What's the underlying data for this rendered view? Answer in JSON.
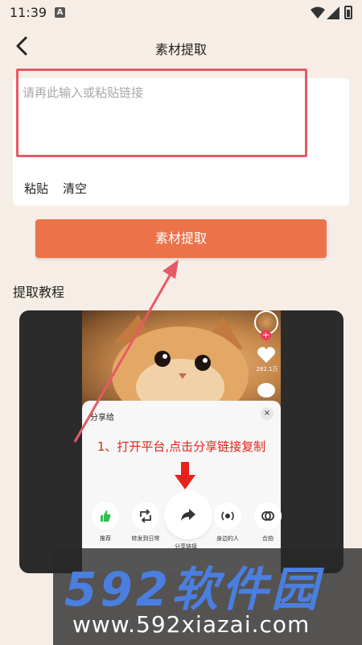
{
  "status_bar": {
    "time": "11:39",
    "notification_badge": "A"
  },
  "header": {
    "title": "素材提取"
  },
  "input_card": {
    "placeholder": "请再此输入或粘贴链接",
    "paste_label": "粘贴",
    "clear_label": "清空",
    "highlight_color": "#e65a66"
  },
  "extract_button": {
    "label": "素材提取",
    "color": "#ec7249"
  },
  "tutorial": {
    "heading": "提取教程",
    "like_count": "282.1万",
    "share_title": "分享给",
    "close_symbol": "×",
    "instruction": "1、打开平台,点击分享链接复制",
    "instruction_color": "#e8211a",
    "share_items": [
      {
        "label": "推荐",
        "icon": "thumbs-up-icon"
      },
      {
        "label": "转发到日常",
        "icon": "repost-icon"
      },
      {
        "label": "分享链接",
        "icon": "share-arrow-icon"
      },
      {
        "label": "身边的人",
        "icon": "nearby-icon"
      },
      {
        "label": "合拍",
        "icon": "duet-icon"
      }
    ]
  },
  "watermark": {
    "logo": "592软件园",
    "url": "www.592xiazai.com"
  }
}
